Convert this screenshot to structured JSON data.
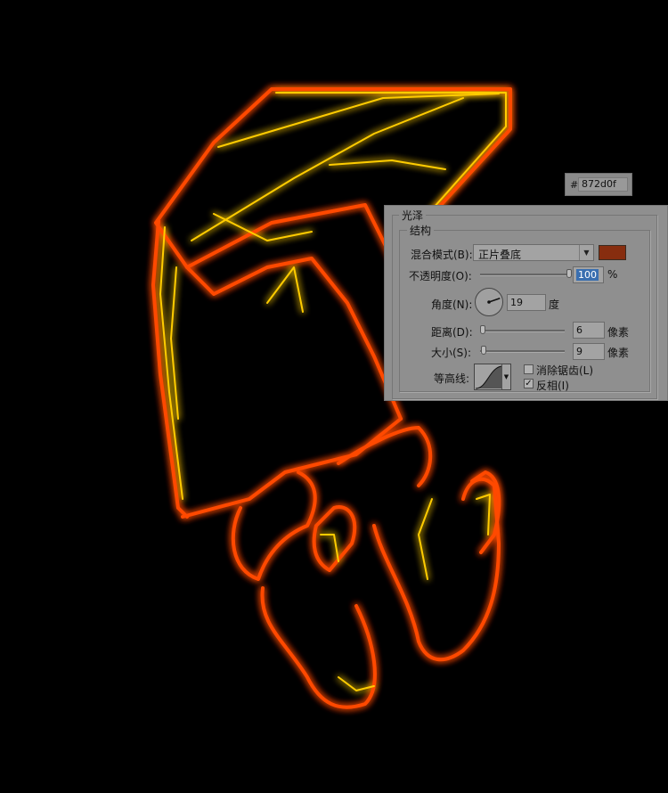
{
  "color_picker": {
    "hash": "#",
    "hex_value": "872d0f"
  },
  "panel": {
    "title": "光泽",
    "group_title": "结构",
    "blend_mode": {
      "label": "混合模式(B):",
      "value": "正片叠底",
      "color": "#872d0f"
    },
    "opacity": {
      "label": "不透明度(O):",
      "value": "100",
      "unit": "%",
      "fraction": 1.0
    },
    "angle": {
      "label": "角度(N):",
      "value": "19",
      "unit": "度",
      "degrees": 19
    },
    "distance": {
      "label": "距离(D):",
      "value": "6",
      "unit": "像素",
      "fraction": 0.03
    },
    "size": {
      "label": "大小(S):",
      "value": "9",
      "unit": "像素",
      "fraction": 0.04
    },
    "contour": {
      "label": "等高线:"
    },
    "anti_alias": {
      "label": "消除锯齿(L)",
      "checked": false
    },
    "invert": {
      "label": "反相(I)",
      "checked": true,
      "mark": "✓"
    }
  },
  "colors": {
    "glow_outer": "#ff5a00",
    "glow_inner": "#ffd200",
    "background": "#000000"
  }
}
